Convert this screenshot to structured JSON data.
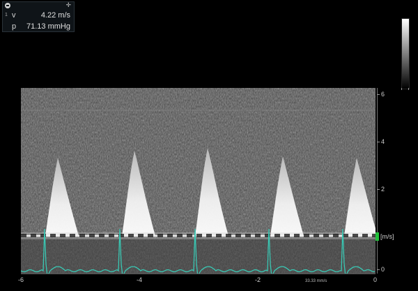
{
  "measurements": [
    {
      "index": "1",
      "label": "v",
      "value": "4.22 m/s"
    },
    {
      "index": "",
      "label": "p",
      "value": "71.13 mmHg"
    }
  ],
  "velocity_axis": {
    "ticks": [
      "6",
      "4",
      "2",
      "0"
    ],
    "unit_label": "[m/s]"
  },
  "time_axis": {
    "ticks": [
      "-6",
      "-4",
      "-2",
      "0"
    ],
    "sweep_label": "33.33 mm/s"
  },
  "colors": {
    "ecg_trace": "#39c8b4",
    "unit_marker": "#22c03a",
    "spectrum_background": "#5c5c5c"
  },
  "icons": [
    "collapse-icon",
    "move-icon"
  ]
}
